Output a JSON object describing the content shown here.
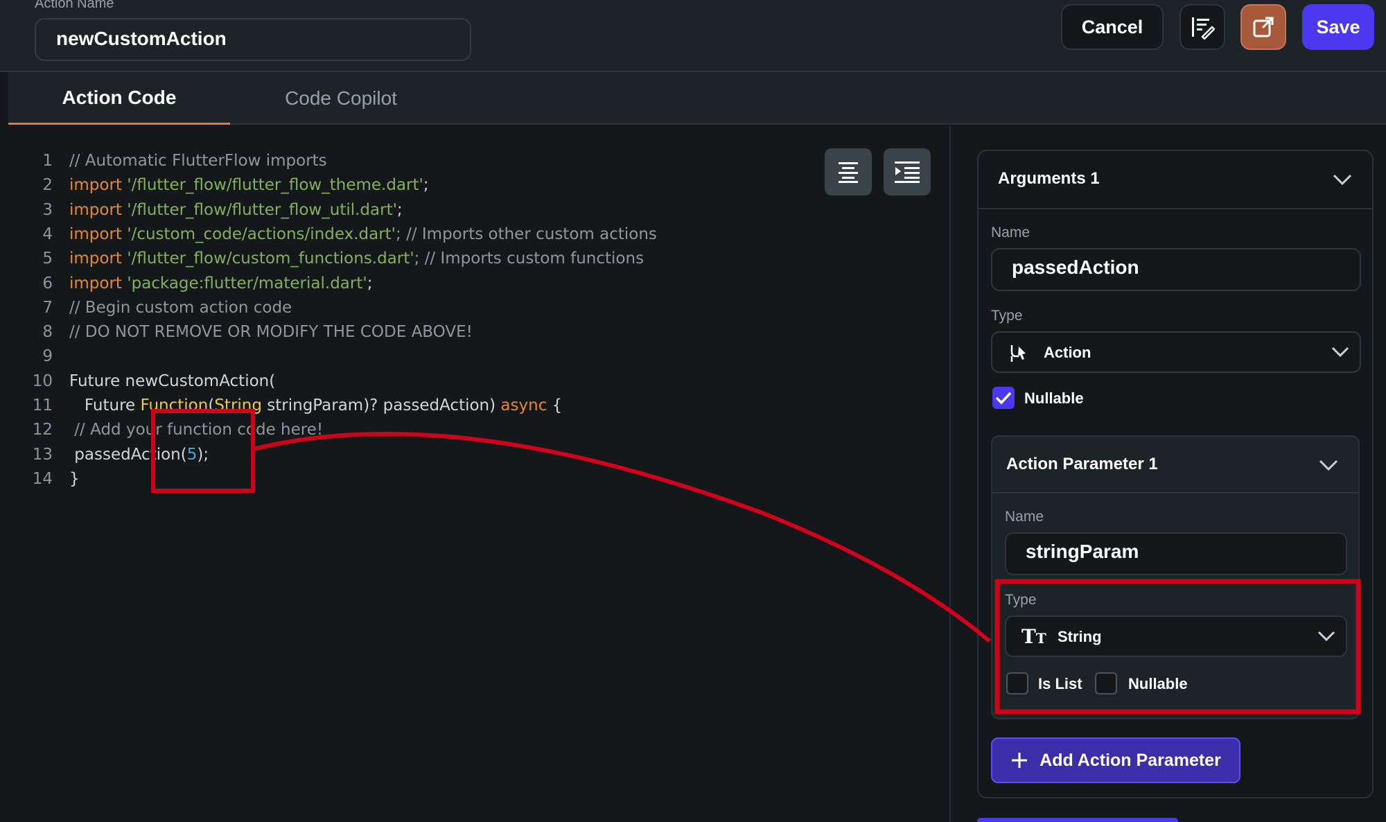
{
  "header": {
    "action_name_label": "Action Name",
    "action_name_value": "newCustomAction",
    "cancel_label": "Cancel",
    "save_label": "Save",
    "format_icon": "format-code-icon",
    "open_icon": "open-external-icon"
  },
  "tabs": [
    {
      "label": "Action Code",
      "active": true
    },
    {
      "label": "Code Copilot",
      "active": false
    }
  ],
  "editor": {
    "align_icon": "align-center-icon",
    "indent_icon": "indent-icon",
    "line_numbers": [
      "1",
      "2",
      "3",
      "4",
      "5",
      "6",
      "7",
      "8",
      "9",
      "10",
      "11",
      "12",
      "13",
      "14"
    ],
    "lines": [
      [
        {
          "t": "// Automatic FlutterFlow imports",
          "c": "com"
        }
      ],
      [
        {
          "t": "import ",
          "c": "kw"
        },
        {
          "t": "'/flutter_flow/flutter_flow_theme.dart'",
          "c": "str"
        },
        {
          "t": ";",
          "c": "plain"
        }
      ],
      [
        {
          "t": "import ",
          "c": "kw"
        },
        {
          "t": "'/flutter_flow/flutter_flow_util.dart'",
          "c": "str"
        },
        {
          "t": ";",
          "c": "plain"
        }
      ],
      [
        {
          "t": "import ",
          "c": "kw"
        },
        {
          "t": "'/custom_code/actions/index.dart'",
          "c": "str"
        },
        {
          "t": "; // Imports other custom actions",
          "c": "com"
        }
      ],
      [
        {
          "t": "import ",
          "c": "kw"
        },
        {
          "t": "'/flutter_flow/custom_functions.dart'",
          "c": "str"
        },
        {
          "t": "; // Imports custom functions",
          "c": "com"
        }
      ],
      [
        {
          "t": "import ",
          "c": "kw"
        },
        {
          "t": "'package:flutter/material.dart'",
          "c": "str"
        },
        {
          "t": ";",
          "c": "plain"
        }
      ],
      [
        {
          "t": "// Begin custom action code",
          "c": "com"
        }
      ],
      [
        {
          "t": "// DO NOT REMOVE OR MODIFY THE CODE ABOVE!",
          "c": "com"
        }
      ],
      [],
      [
        {
          "t": "Future newCustomAction(",
          "c": "plain"
        }
      ],
      [
        {
          "t": "   Future ",
          "c": "plain"
        },
        {
          "t": "Function",
          "c": "fn"
        },
        {
          "t": "(",
          "c": "plain"
        },
        {
          "t": "String",
          "c": "fn"
        },
        {
          "t": " stringParam)? passedAction) ",
          "c": "plain"
        },
        {
          "t": "async",
          "c": "kw"
        },
        {
          "t": " {",
          "c": "plain"
        }
      ],
      [
        {
          "t": " // Add your function code here!",
          "c": "com"
        }
      ],
      [
        {
          "t": " passedAction(",
          "c": "plain"
        },
        {
          "t": "5",
          "c": "num"
        },
        {
          "t": ");",
          "c": "plain"
        }
      ],
      [
        {
          "t": "}",
          "c": "plain"
        }
      ]
    ]
  },
  "panel": {
    "title": "Arguments 1",
    "name_label": "Name",
    "name_value": "passedAction",
    "type_label": "Type",
    "type_value": "Action",
    "type_icon": "action-flow-icon",
    "nullable_label": "Nullable",
    "nullable_checked": true,
    "param": {
      "title": "Action Parameter 1",
      "name_label": "Name",
      "name_value": "stringParam",
      "type_label": "Type",
      "type_value": "String",
      "type_icon": "text-type-icon",
      "is_list_label": "Is List",
      "is_list_checked": false,
      "nullable_label": "Nullable",
      "nullable_checked": false
    },
    "add_param_label": "Add Action Parameter",
    "add_icon": "plus-icon"
  },
  "colors": {
    "accent": "#4b39ef",
    "tab_underline": "#e8743f",
    "annotation": "#d0021b"
  }
}
